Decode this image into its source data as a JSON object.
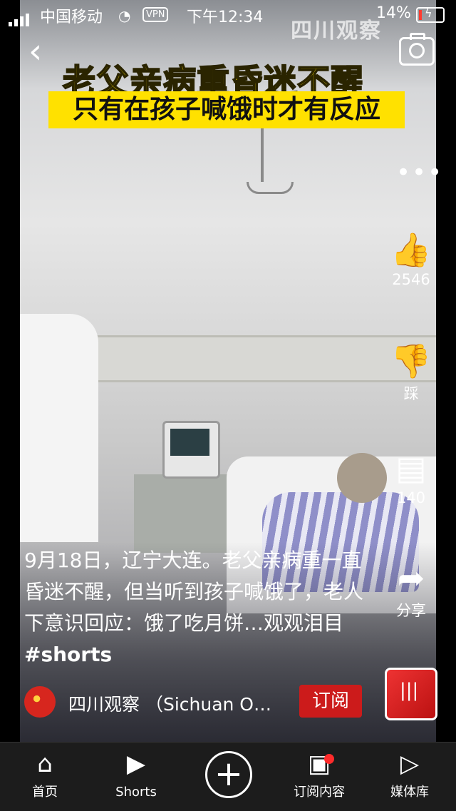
{
  "status_bar": {
    "carrier": "中国移动",
    "vpn": "VPN",
    "time": "下午12:34",
    "battery": "14%",
    "battery_level": 0.14
  },
  "video": {
    "title_line1": "老父亲病重昏迷不醒",
    "title_line2": "只有在孩子喊饿时才有反应",
    "watermark": "四川观察"
  },
  "right_rail": {
    "like_count": "2546",
    "dislike_label": "踩",
    "comment_count": "140",
    "share_label": "分享"
  },
  "caption": {
    "text": "9月18日，辽宁大连。老父亲病重一直昏迷不醒，但当听到孩子喊饿了，老人下意识回应：饿了吃月饼…观观泪目",
    "hashtag": "#shorts"
  },
  "channel": {
    "name": "四川观察 （Sichuan O…",
    "subscribe_label": "订阅"
  },
  "nav": {
    "items": [
      {
        "label": "首页",
        "icon": "home-icon"
      },
      {
        "label": "Shorts",
        "icon": "shorts-icon"
      },
      {
        "label": "",
        "icon": "add-icon"
      },
      {
        "label": "订阅内容",
        "icon": "subscriptions-icon"
      },
      {
        "label": "媒体库",
        "icon": "library-icon"
      }
    ]
  },
  "colors": {
    "title_yellow": "#ffe100",
    "subscribe_red": "#cc1b1b",
    "nav_bg": "#1c1c1c"
  }
}
